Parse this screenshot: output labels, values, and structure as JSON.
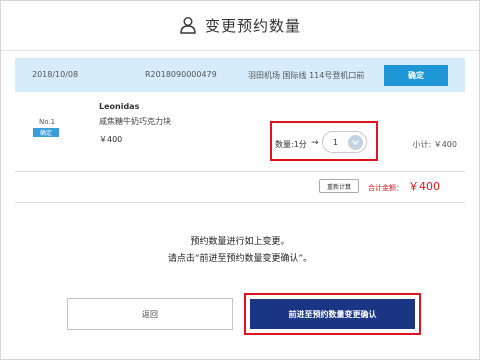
{
  "header": {
    "title": "变更预约数量"
  },
  "reservation": {
    "date": "2018/10/08",
    "order_number": "R2018090000479",
    "location": "羽田机场 国际线 114号登机口前",
    "confirm_label": "确定"
  },
  "item": {
    "number": "No.1",
    "status": "确定",
    "brand": "Leonidas",
    "product": "咸焦糖牛奶巧克力块",
    "price": "￥400",
    "quantity_label": "数量:1分",
    "arrow": "→",
    "quantity_value": "1",
    "subtotal": "小计: ￥400"
  },
  "totals": {
    "recalculate_label": "重新计算",
    "total_label": "合计金额：",
    "total_value": "￥400"
  },
  "message": {
    "line1": "预约数量进行如上变更。",
    "line2": "请点击“前进至预约数量变更确认”。"
  },
  "actions": {
    "back_label": "返回",
    "proceed_label": "前进至预约数量变更确认"
  },
  "colors": {
    "accent_blue": "#1e96d6",
    "info_bar_bg": "#d6ecfa",
    "primary_navy": "#1a3584",
    "highlight_red": "#e0141e"
  }
}
